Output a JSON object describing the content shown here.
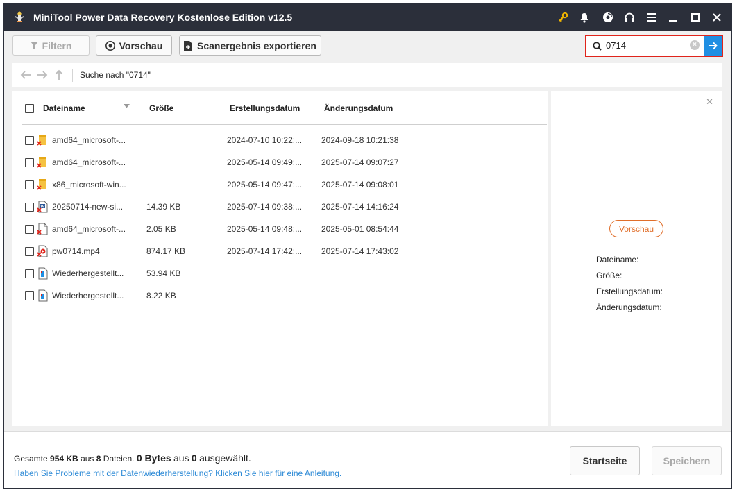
{
  "app": {
    "title": "MiniTool Power Data Recovery Kostenlose Edition v12.5"
  },
  "toolbar": {
    "filter_label": "Filtern",
    "preview_label": "Vorschau",
    "export_label": "Scanergebnis exportieren"
  },
  "search": {
    "value": "0714"
  },
  "nav": {
    "path_text": "Suche nach \"0714\""
  },
  "table": {
    "columns": {
      "name": "Dateiname",
      "size": "Größe",
      "created": "Erstellungsdatum",
      "modified": "Änderungsdatum"
    },
    "rows": [
      {
        "name": "amd64_microsoft-...",
        "size": "",
        "created": "2024-07-10 10:22:...",
        "modified": "2024-09-18 10:21:38",
        "icon": "deleted-folder-icon"
      },
      {
        "name": "amd64_microsoft-...",
        "size": "",
        "created": "2025-05-14 09:49:...",
        "modified": "2025-07-14 09:07:27",
        "icon": "deleted-folder-icon"
      },
      {
        "name": "x86_microsoft-win...",
        "size": "",
        "created": "2025-05-14 09:47:...",
        "modified": "2025-07-14 09:08:01",
        "icon": "deleted-folder-icon"
      },
      {
        "name": "20250714-new-si...",
        "size": "14.39 KB",
        "created": "2025-07-14 09:38:...",
        "modified": "2025-07-14 14:16:24",
        "icon": "deleted-word-file-icon"
      },
      {
        "name": "amd64_microsoft-...",
        "size": "2.05 KB",
        "created": "2025-05-14 09:48:...",
        "modified": "2025-05-01 08:54:44",
        "icon": "deleted-file-icon"
      },
      {
        "name": "pw0714.mp4",
        "size": "874.17 KB",
        "created": "2025-07-14 17:42:...",
        "modified": "2025-07-14 17:43:02",
        "icon": "deleted-video-file-icon"
      },
      {
        "name": "Wiederhergestellt...",
        "size": "53.94 KB",
        "created": "",
        "modified": "",
        "icon": "recovered-file-icon"
      },
      {
        "name": "Wiederhergestellt...",
        "size": "8.22 KB",
        "created": "",
        "modified": "",
        "icon": "recovered-file-icon"
      }
    ]
  },
  "preview_pane": {
    "button_label": "Vorschau",
    "filename_label": "Dateiname:",
    "size_label": "Größe:",
    "created_label": "Erstellungsdatum:",
    "modified_label": "Änderungsdatum:"
  },
  "footer": {
    "total_prefix": "Gesamte",
    "total_size": "954 KB",
    "total_mid": "aus",
    "total_count": "8",
    "total_suffix": "Dateien.",
    "selected_bytes": "0 Bytes",
    "selected_mid": "aus",
    "selected_count": "0",
    "selected_suffix": "ausgewählt.",
    "help_link": "Haben Sie Probleme mit der Datenwiederherstellung? Klicken Sie hier für eine Anleitung.",
    "home_label": "Startseite",
    "save_label": "Speichern"
  },
  "colors": {
    "titlebar": "#2b2f3a",
    "accent_blue": "#1f8fe3",
    "highlight_red": "#e0241b",
    "preview_orange": "#e06e2a",
    "key_icon": "#f2b600"
  }
}
